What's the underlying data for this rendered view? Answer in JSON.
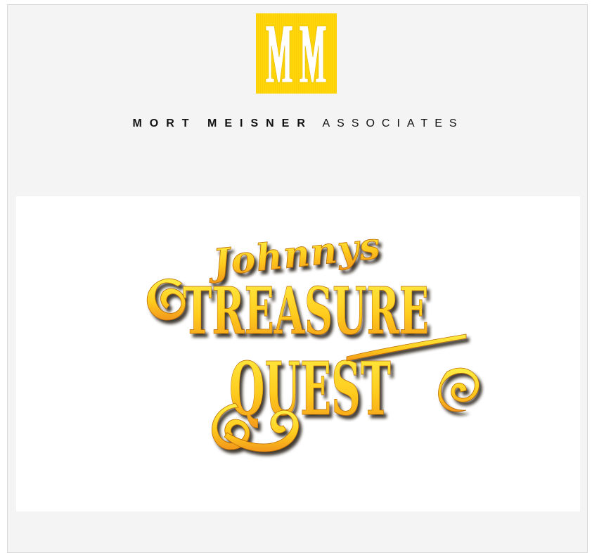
{
  "agency": {
    "monogram": "MM",
    "name_bold": "MORT MEISNER",
    "name_light": "ASSOCIATES",
    "brand_color": "#ffd60a"
  },
  "show_logo": {
    "line1": "Johnnys",
    "line2": "TREASURE",
    "line3": "QUEST",
    "gradient_top": "#ffec3a",
    "gradient_bottom": "#f29a16",
    "shadow_color": "#1a1208"
  }
}
